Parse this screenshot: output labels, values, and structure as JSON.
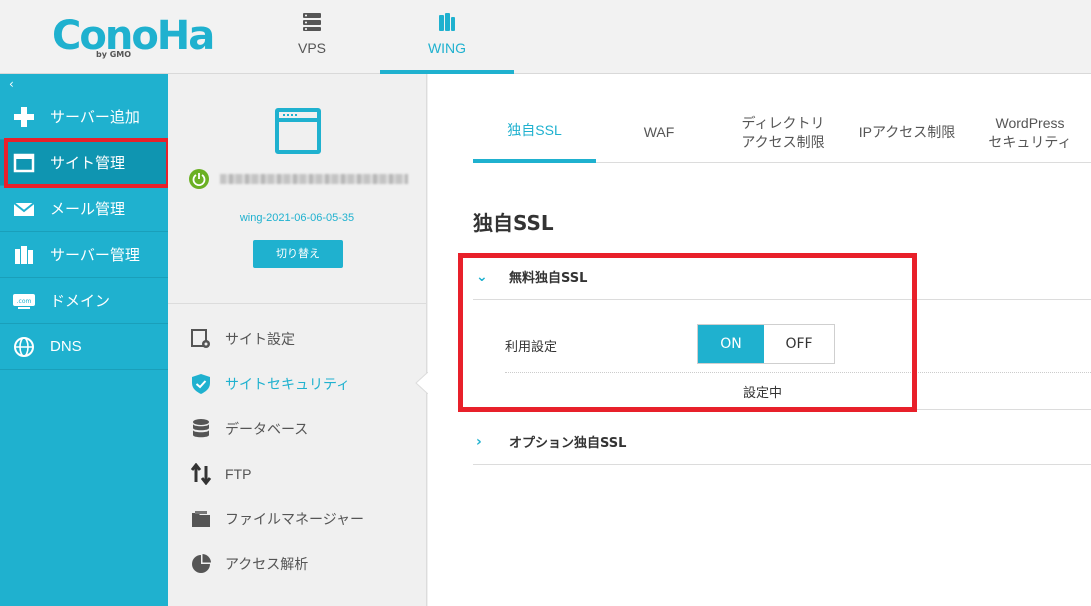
{
  "brand": {
    "logo_text": "ConoHa",
    "logo_sub": "by GMO"
  },
  "top_tabs": [
    {
      "label": "VPS",
      "icon": "server-icon"
    },
    {
      "label": "WING",
      "icon": "wing-icon",
      "active": true
    }
  ],
  "sidebar": {
    "collapse_glyph": "‹",
    "items": [
      {
        "label": "サーバー追加",
        "icon": "plus-icon"
      },
      {
        "label": "サイト管理",
        "icon": "window-icon",
        "active": true
      },
      {
        "label": "メール管理",
        "icon": "mail-icon"
      },
      {
        "label": "サーバー管理",
        "icon": "server-manage-icon"
      },
      {
        "label": "ドメイン",
        "icon": "domain-icon"
      },
      {
        "label": "DNS",
        "icon": "globe-icon"
      }
    ]
  },
  "site": {
    "name": "wing-2021-06-06-05-35",
    "switch_label": "切り替え",
    "menu": [
      {
        "label": "サイト設定",
        "icon": "site-settings-icon"
      },
      {
        "label": "サイトセキュリティ",
        "icon": "shield-icon",
        "active": true
      },
      {
        "label": "データベース",
        "icon": "database-icon"
      },
      {
        "label": "FTP",
        "icon": "transfer-icon"
      },
      {
        "label": "ファイルマネージャー",
        "icon": "folder-icon"
      },
      {
        "label": "アクセス解析",
        "icon": "pie-chart-icon"
      }
    ]
  },
  "main": {
    "tabs": [
      {
        "label": "独自SSL",
        "active": true
      },
      {
        "label": "WAF"
      },
      {
        "label": "ディレクトリ\nアクセス制限"
      },
      {
        "label": "IPアクセス制限"
      },
      {
        "label": "WordPress\nセキュリティ"
      }
    ],
    "section_title": "独自SSL",
    "free_ssl": {
      "title": "無料独自SSL",
      "setting_label": "利用設定",
      "on_label": "ON",
      "off_label": "OFF",
      "state": "ON",
      "status": "設定中"
    },
    "option_ssl": {
      "title": "オプション独自SSL"
    }
  },
  "colors": {
    "accent": "#1fb1cf",
    "highlight": "#e8202a",
    "power": "#6ab023"
  }
}
